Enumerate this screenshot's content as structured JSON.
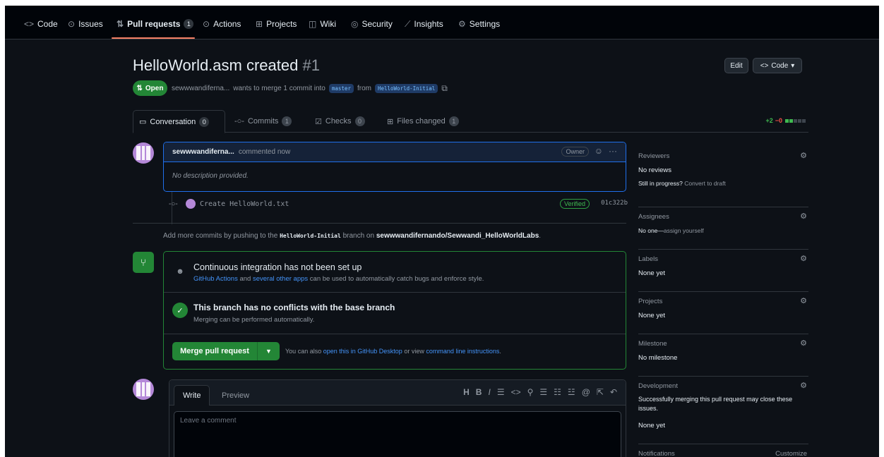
{
  "repo_nav": {
    "tabs": [
      {
        "icon": "code-icon",
        "glyph": "<>",
        "label": "Code"
      },
      {
        "icon": "issue-icon",
        "glyph": "⊙",
        "label": "Issues"
      },
      {
        "icon": "pull-request-icon",
        "glyph": "⇅",
        "label": "Pull requests",
        "count": "1"
      },
      {
        "icon": "play-icon",
        "glyph": "⊙",
        "label": "Actions"
      },
      {
        "icon": "table-icon",
        "glyph": "⊞",
        "label": "Projects"
      },
      {
        "icon": "book-icon",
        "glyph": "◫",
        "label": "Wiki"
      },
      {
        "icon": "shield-icon",
        "glyph": "◎",
        "label": "Security"
      },
      {
        "icon": "graph-icon",
        "glyph": "⟋",
        "label": "Insights"
      },
      {
        "icon": "gear-icon",
        "glyph": "⚙",
        "label": "Settings"
      }
    ]
  },
  "pr": {
    "title": "HelloWorld.asm created",
    "number": "#1",
    "state": "Open",
    "author": "sewwwandiferna...",
    "meta_middle": "wants to merge 1 commit into",
    "base_branch": "master",
    "from_word": "from",
    "head_branch": "HelloWorld-Initial",
    "edit_label": "Edit",
    "code_label": "Code"
  },
  "pr_tabs": [
    {
      "icon": "comment-icon",
      "label": "Conversation",
      "count": "0"
    },
    {
      "icon": "commit-icon",
      "label": "Commits",
      "count": "1"
    },
    {
      "icon": "checklist-icon",
      "label": "Checks",
      "count": "0"
    },
    {
      "icon": "file-diff-icon",
      "label": "Files changed",
      "count": "1"
    }
  ],
  "diffstat": {
    "additions": "+2",
    "deletions": "−0"
  },
  "comment": {
    "author": "sewwwandiferna...",
    "action": "commented now",
    "role": "Owner",
    "body": "No description provided."
  },
  "commit": {
    "message": "Create HelloWorld.txt",
    "verified": "Verified",
    "sha": "01c322b"
  },
  "push_info": {
    "prefix": "Add more commits by pushing to the",
    "branch": "HelloWorld-Initial",
    "middle": "branch on",
    "repo": "sewwwandifernando/Sewwandi_HelloWorldLabs",
    "suffix": "."
  },
  "merge": {
    "ci_title": "Continuous integration has not been set up",
    "ci_link1": "GitHub Actions",
    "ci_and": "and",
    "ci_link2": "several other apps",
    "ci_rest": "can be used to automatically catch bugs and enforce style.",
    "conflict_title": "This branch has no conflicts with the base branch",
    "conflict_sub": "Merging can be performed automatically.",
    "button": "Merge pull request",
    "also_prefix": "You can also",
    "also_link1": "open this in GitHub Desktop",
    "also_middle": "or view",
    "also_link2": "command line instructions",
    "also_suffix": "."
  },
  "write": {
    "tab_write": "Write",
    "tab_preview": "Preview",
    "placeholder": "Leave a comment",
    "toolbar": [
      {
        "name": "heading-icon",
        "glyph": "H"
      },
      {
        "name": "bold-icon",
        "glyph": "B"
      },
      {
        "name": "italic-icon",
        "glyph": "I"
      },
      {
        "name": "quote-icon",
        "glyph": "☰"
      },
      {
        "name": "code-icon",
        "glyph": "<>"
      },
      {
        "name": "link-icon",
        "glyph": "⚲"
      },
      {
        "name": "bullet-list-icon",
        "glyph": "☰"
      },
      {
        "name": "numbered-list-icon",
        "glyph": "☷"
      },
      {
        "name": "task-list-icon",
        "glyph": "☳"
      },
      {
        "name": "mention-icon",
        "glyph": "@"
      },
      {
        "name": "cross-reference-icon",
        "glyph": "⇱"
      },
      {
        "name": "undo-icon",
        "glyph": "↶"
      }
    ]
  },
  "sidebar": {
    "reviewers": {
      "heading": "Reviewers",
      "value": "No reviews",
      "draft_prefix": "Still in progress?",
      "draft_link": "Convert to draft"
    },
    "assignees": {
      "heading": "Assignees",
      "value": "No one—",
      "link": "assign yourself"
    },
    "labels": {
      "heading": "Labels",
      "value": "None yet"
    },
    "projects": {
      "heading": "Projects",
      "value": "None yet"
    },
    "milestone": {
      "heading": "Milestone",
      "value": "No milestone"
    },
    "development": {
      "heading": "Development",
      "text": "Successfully merging this pull request may close these issues.",
      "value": "None yet"
    },
    "notifications": {
      "heading": "Notifications",
      "customize": "Customize"
    }
  },
  "colors": {
    "accent_green": "#238636",
    "accent_blue": "#1f6feb",
    "tab_underline": "#f78166",
    "background": "#0d1117"
  }
}
